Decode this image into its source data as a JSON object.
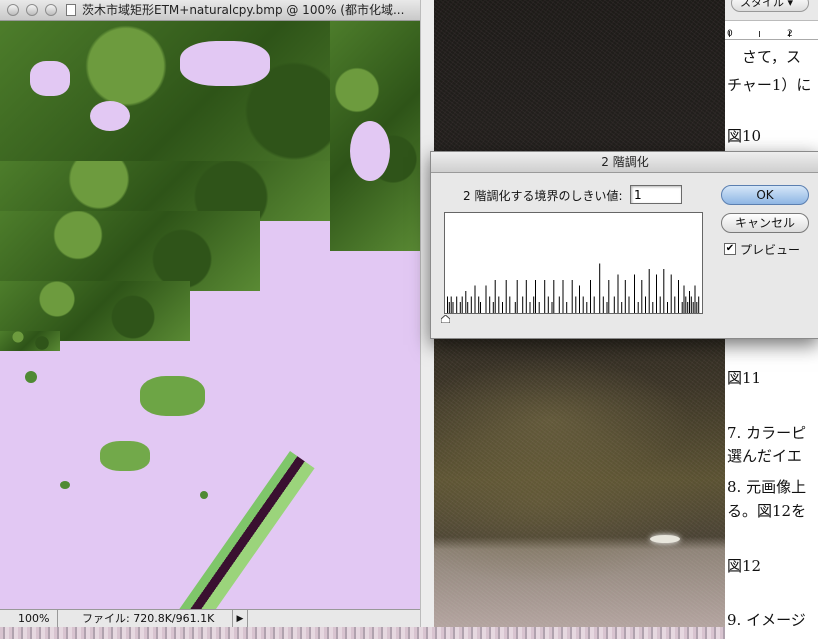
{
  "image_window": {
    "title": "茨木市域矩形ETM+naturalcpy.bmp @ 100% (都市化域...",
    "zoom": "100%",
    "file_info": "ファイル: 720.8K/961.1K",
    "status_arrow": "▶"
  },
  "document": {
    "style_button": "スタイル ▾",
    "ruler_labels": [
      "0",
      "2"
    ],
    "lines": [
      {
        "text": "　さて，ス"
      },
      {
        "text": "チャー1）に"
      },
      {
        "text": "図10"
      },
      {
        "text": "図11"
      },
      {
        "text": "7. カラーピ"
      },
      {
        "text": "選んだイエ"
      },
      {
        "text": "8. 元画像上"
      },
      {
        "text": "る。図12を"
      },
      {
        "text": "図12"
      },
      {
        "text": "9. イメージ"
      }
    ]
  },
  "dialog": {
    "title": "2 階調化",
    "threshold_label": "2 階調化する境界のしきい値:",
    "threshold_value": "1",
    "ok_label": "OK",
    "cancel_label": "キャンセル",
    "preview_label": "プレビュー",
    "preview_checked": true,
    "histogram": [
      3,
      2,
      3,
      2,
      0,
      3,
      0,
      2,
      3,
      0,
      4,
      2,
      0,
      3,
      0,
      5,
      0,
      3,
      2,
      0,
      0,
      5,
      0,
      3,
      0,
      2,
      6,
      0,
      3,
      0,
      2,
      0,
      6,
      0,
      3,
      0,
      0,
      2,
      6,
      0,
      0,
      3,
      0,
      6,
      0,
      2,
      0,
      3,
      6,
      0,
      2,
      0,
      0,
      6,
      0,
      3,
      0,
      2,
      6,
      0,
      0,
      3,
      0,
      6,
      0,
      2,
      0,
      0,
      6,
      0,
      3,
      0,
      5,
      0,
      3,
      0,
      2,
      0,
      6,
      0,
      3,
      0,
      0,
      9,
      0,
      3,
      0,
      2,
      6,
      0,
      0,
      3,
      0,
      7,
      0,
      2,
      0,
      6,
      0,
      3,
      0,
      0,
      7,
      0,
      2,
      0,
      6,
      0,
      3,
      0,
      8,
      0,
      2,
      0,
      7,
      0,
      3,
      0,
      8,
      0,
      2,
      0,
      7,
      0,
      3,
      0,
      6,
      0,
      2,
      5,
      3,
      2,
      4,
      3,
      2,
      5,
      2,
      3
    ]
  }
}
